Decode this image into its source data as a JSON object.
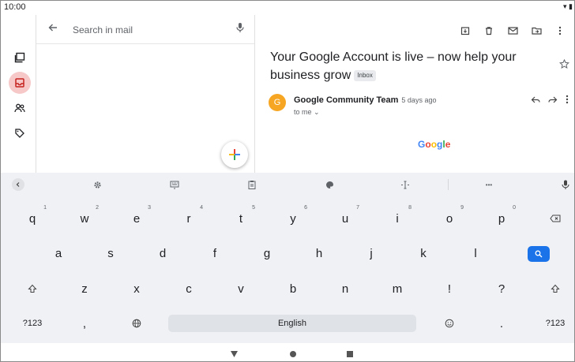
{
  "status": {
    "time": "10:00",
    "system_glyph": "▾ ▮"
  },
  "rail": [
    {
      "icon": "all-inboxes-icon"
    },
    {
      "icon": "inbox-icon",
      "active": true
    },
    {
      "icon": "contacts-icon"
    },
    {
      "icon": "labels-icon"
    }
  ],
  "search": {
    "placeholder": "Search in mail"
  },
  "email": {
    "subject": "Your Google Account is live – now help your business grow",
    "label": "Inbox",
    "sender_initial": "G",
    "sender": "Google Community Team",
    "time": "5 days ago",
    "recipient": "to me",
    "recipient_chevron": "⌄",
    "body_logo": [
      "G",
      "o",
      "o",
      "g",
      "l",
      "e"
    ]
  },
  "colors": {
    "accent": "#1a73e8",
    "inbox_active": "#f6c8c8",
    "avatar": "#f6a623",
    "keyboard_bg": "#eff1f4"
  },
  "keyboard": {
    "row1": [
      {
        "k": "q",
        "h": "1"
      },
      {
        "k": "w",
        "h": "2"
      },
      {
        "k": "e",
        "h": "3"
      },
      {
        "k": "r",
        "h": "4"
      },
      {
        "k": "t",
        "h": "5"
      },
      {
        "k": "y",
        "h": "6"
      },
      {
        "k": "u",
        "h": "7"
      },
      {
        "k": "i",
        "h": "8"
      },
      {
        "k": "o",
        "h": "9"
      },
      {
        "k": "p",
        "h": "0"
      }
    ],
    "row2": [
      "a",
      "s",
      "d",
      "f",
      "g",
      "h",
      "j",
      "k",
      "l"
    ],
    "row3": [
      "z",
      "x",
      "c",
      "v",
      "b",
      "n",
      "m",
      "!",
      "?"
    ],
    "symbols_label": "?123",
    "comma": ",",
    "space_label": "English",
    "period": ".",
    "toolbar_more": "•••"
  }
}
